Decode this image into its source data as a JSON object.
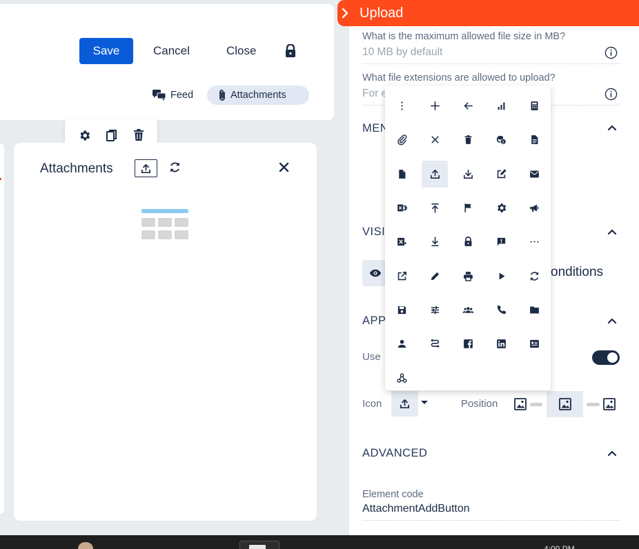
{
  "toolbar": {
    "save_label": "Save",
    "cancel_label": "Cancel",
    "close_label": "Close"
  },
  "subtabs": {
    "feed": "Feed",
    "attachments": "Attachments"
  },
  "widget": {
    "title": "Attachments"
  },
  "panel": {
    "title": "Upload",
    "max_size_question": "What is the maximum allowed file size in MB?",
    "max_size_value": "10 MB by default",
    "extensions_question": "What file extensions are allowed to upload?",
    "extensions_value": "For e",
    "sections": {
      "menu": "MEN",
      "visibility": "VISI",
      "appearance": "APP",
      "advanced": "ADVANCED"
    },
    "visibility_conditions": "onditions",
    "use_label": "Use",
    "icon_label": "Icon",
    "position_label": "Position",
    "element_code_label": "Element code",
    "element_code_value": "AttachmentAddButton",
    "use_toggle_on": true
  },
  "icon_picker": {
    "selected": "upload-icon",
    "icons": [
      "more-vertical",
      "plus",
      "arrow-left",
      "bar-chart",
      "calculator",
      "paperclip",
      "close",
      "trash",
      "coins",
      "document",
      "file",
      "upload",
      "download",
      "edit-square",
      "mail",
      "excel-export",
      "upload-to-top",
      "flag",
      "settings",
      "megaphone",
      "excel",
      "download-to-bottom",
      "lock",
      "feedback",
      "more-horizontal",
      "open-in-new",
      "pencil",
      "print",
      "play",
      "sync",
      "save",
      "tune",
      "group",
      "phone",
      "folder",
      "person",
      "route",
      "facebook",
      "linkedin",
      "id-card",
      "webhook"
    ]
  },
  "taskbar": {
    "clock": "4:00 PM"
  },
  "colors": {
    "accent": "#0a5bd8",
    "header": "#ff4a1c",
    "navy": "#1c2b45"
  }
}
